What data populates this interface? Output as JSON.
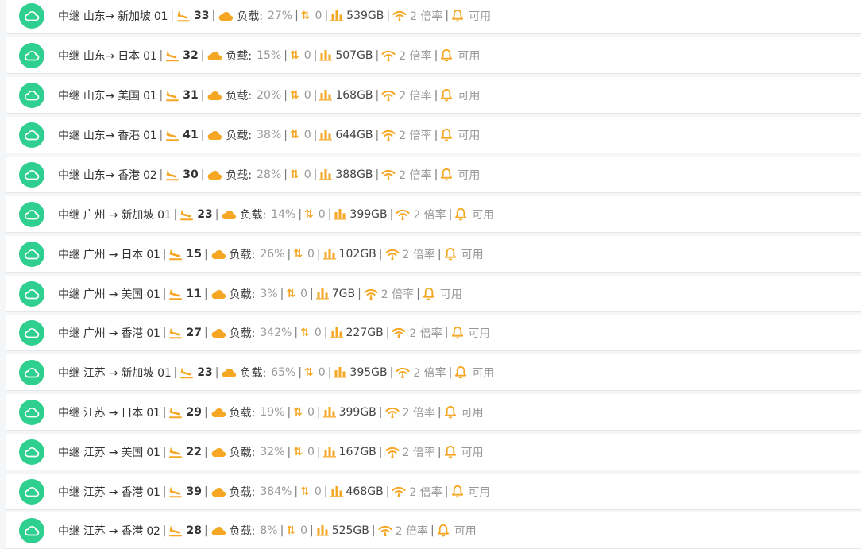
{
  "rows": [
    {
      "name": "中继 山东→ 新加坡 01",
      "count": "33",
      "load_label": "负载:",
      "load": "27%",
      "conn": "0",
      "traffic": "539GB",
      "rate": "2 倍率",
      "status": "可用"
    },
    {
      "name": "中继 山东→ 日本 01",
      "count": "32",
      "load_label": "负载:",
      "load": "15%",
      "conn": "0",
      "traffic": "507GB",
      "rate": "2 倍率",
      "status": "可用"
    },
    {
      "name": "中继 山东→ 美国 01",
      "count": "31",
      "load_label": "负载:",
      "load": "20%",
      "conn": "0",
      "traffic": "168GB",
      "rate": "2 倍率",
      "status": "可用"
    },
    {
      "name": "中继 山东→ 香港 01",
      "count": "41",
      "load_label": "负载:",
      "load": "38%",
      "conn": "0",
      "traffic": "644GB",
      "rate": "2 倍率",
      "status": "可用"
    },
    {
      "name": "中继 山东→ 香港 02",
      "count": "30",
      "load_label": "负载:",
      "load": "28%",
      "conn": "0",
      "traffic": "388GB",
      "rate": "2 倍率",
      "status": "可用"
    },
    {
      "name": "中继 广州 → 新加坡 01",
      "count": "23",
      "load_label": "负载:",
      "load": "14%",
      "conn": "0",
      "traffic": "399GB",
      "rate": "2 倍率",
      "status": "可用"
    },
    {
      "name": "中继 广州 → 日本 01",
      "count": "15",
      "load_label": "负载:",
      "load": "26%",
      "conn": "0",
      "traffic": "102GB",
      "rate": "2 倍率",
      "status": "可用"
    },
    {
      "name": "中继 广州 → 美国 01",
      "count": "11",
      "load_label": "负载:",
      "load": "3%",
      "conn": "0",
      "traffic": "7GB",
      "rate": "2 倍率",
      "status": "可用"
    },
    {
      "name": "中继 广州 → 香港 01",
      "count": "27",
      "load_label": "负载:",
      "load": "342%",
      "conn": "0",
      "traffic": "227GB",
      "rate": "2 倍率",
      "status": "可用"
    },
    {
      "name": "中继 江苏 → 新加坡 01",
      "count": "23",
      "load_label": "负载:",
      "load": "65%",
      "conn": "0",
      "traffic": "395GB",
      "rate": "2 倍率",
      "status": "可用"
    },
    {
      "name": "中继 江苏 → 日本 01",
      "count": "29",
      "load_label": "负载:",
      "load": "19%",
      "conn": "0",
      "traffic": "399GB",
      "rate": "2 倍率",
      "status": "可用"
    },
    {
      "name": "中继 江苏 → 美国 01",
      "count": "22",
      "load_label": "负载:",
      "load": "32%",
      "conn": "0",
      "traffic": "167GB",
      "rate": "2 倍率",
      "status": "可用"
    },
    {
      "name": "中继 江苏 → 香港 01",
      "count": "39",
      "load_label": "负载:",
      "load": "384%",
      "conn": "0",
      "traffic": "468GB",
      "rate": "2 倍率",
      "status": "可用"
    },
    {
      "name": "中继 江苏 → 香港 02",
      "count": "28",
      "load_label": "负载:",
      "load": "8%",
      "conn": "0",
      "traffic": "525GB",
      "rate": "2 倍率",
      "status": "可用"
    }
  ],
  "icons": {
    "status": "cloud-icon",
    "users": "plane-landing-icon",
    "load": "cloud-icon",
    "connections": "arrows-up-down-icon",
    "traffic": "bar-chart-icon",
    "rate": "signal-icon",
    "alert": "bell-icon"
  },
  "colors": {
    "status_green": "#2ecf8f",
    "accent_orange": "#f5a623",
    "row_bg": "#ffffff",
    "page_bg": "#f5f6f7"
  }
}
